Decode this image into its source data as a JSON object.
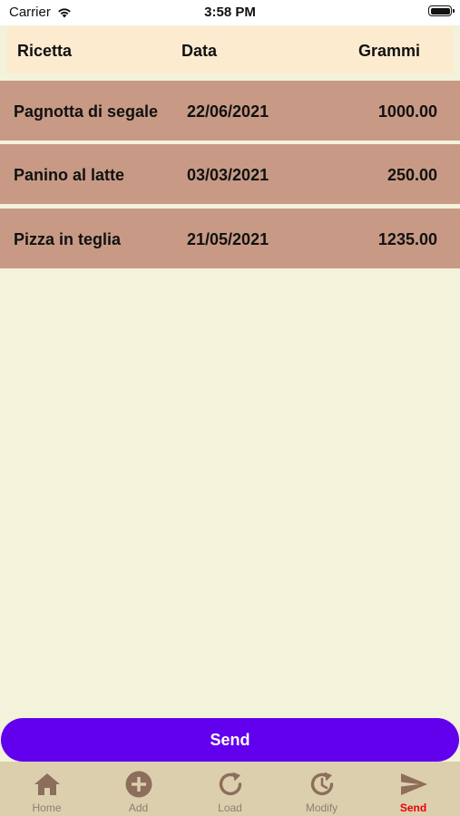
{
  "status": {
    "carrier": "Carrier",
    "time": "3:58 PM"
  },
  "table": {
    "headers": {
      "recipe": "Ricetta",
      "date": "Data",
      "grams": "Grammi"
    },
    "rows": [
      {
        "recipe": "Pagnotta di segale",
        "date": "22/06/2021",
        "grams": "1000.00"
      },
      {
        "recipe": "Panino al latte",
        "date": "03/03/2021",
        "grams": "250.00"
      },
      {
        "recipe": "Pizza in teglia",
        "date": "21/05/2021",
        "grams": "1235.00"
      }
    ]
  },
  "send_button": {
    "label": "Send"
  },
  "tabbar": {
    "items": [
      {
        "label": "Home",
        "icon": "home-icon"
      },
      {
        "label": "Add",
        "icon": "plus-circle-icon"
      },
      {
        "label": "Load",
        "icon": "refresh-icon"
      },
      {
        "label": "Modify",
        "icon": "history-icon"
      },
      {
        "label": "Send",
        "icon": "send-icon"
      }
    ],
    "active": "Send"
  },
  "colors": {
    "background": "#F3F2DA",
    "header": "#FDEBD0",
    "row": "#C89A85",
    "button": "#6200EE",
    "tabbar": "#DCCFAE",
    "icon": "#8C6E5A",
    "active_tab": "#E8000A"
  }
}
